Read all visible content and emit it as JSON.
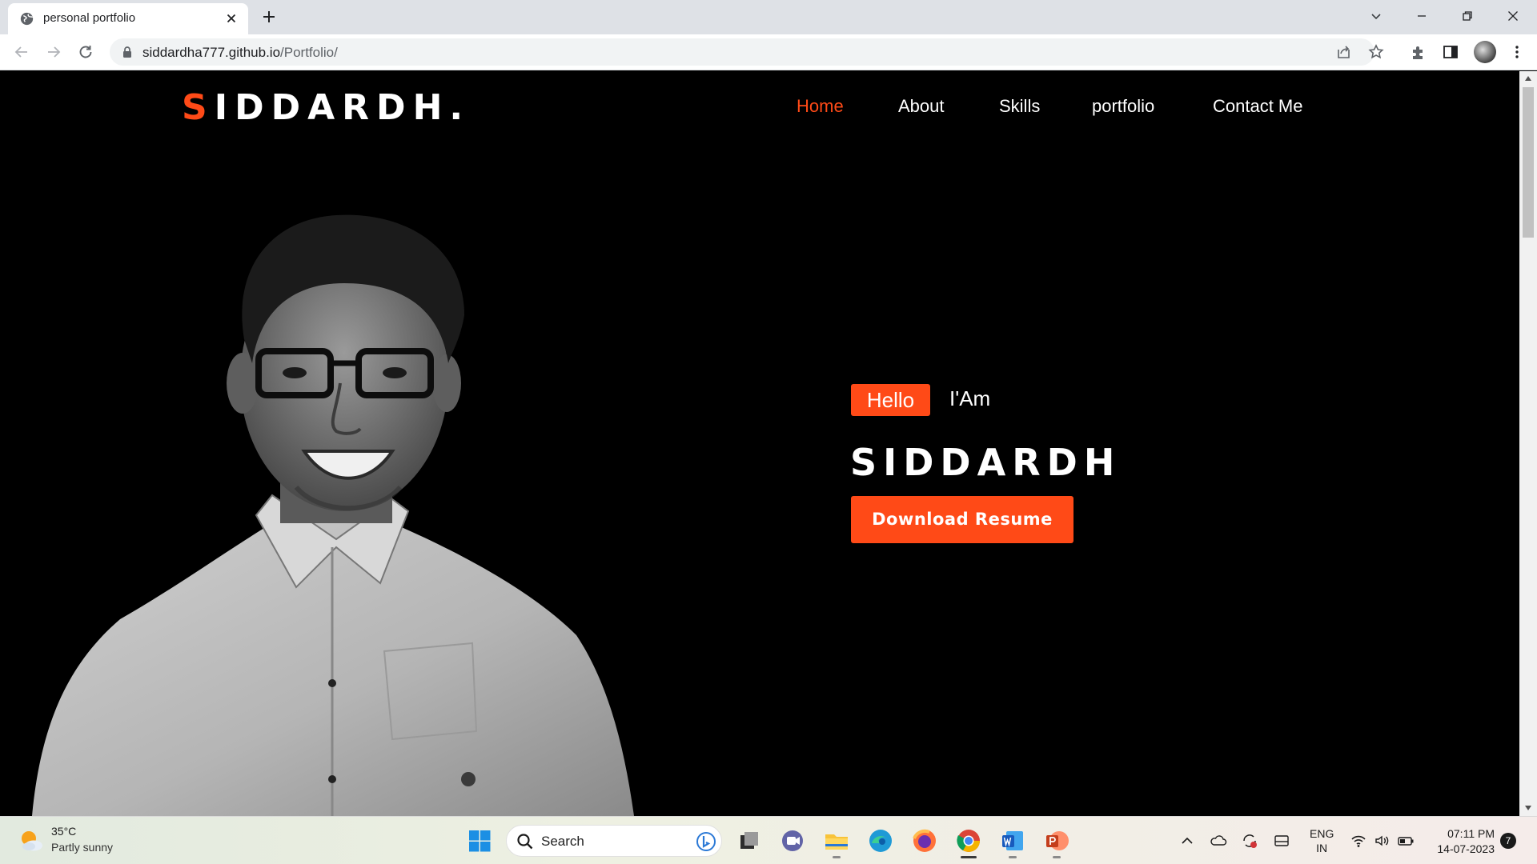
{
  "browser": {
    "tab_title": "personal portfolio",
    "url_host": "siddardha777.github.io",
    "url_path": "/Portfolio/"
  },
  "site": {
    "logo_first": "S",
    "logo_rest": "IDDARDH.",
    "nav": [
      "Home",
      "About",
      "Skills",
      "portfolio",
      "Contact Me"
    ],
    "active_nav": "Home",
    "hello_label": "Hello",
    "iam_label": "I'Am",
    "name": "SIDDARDH",
    "download_label": "Download Resume",
    "accent_color": "#ff4a17"
  },
  "taskbar": {
    "weather_temp": "35°C",
    "weather_desc": "Partly sunny",
    "search_label": "Search",
    "lang_line1": "ENG",
    "lang_line2": "IN",
    "time": "07:11 PM",
    "date": "14-07-2023",
    "notification_count": "7",
    "pinned_apps": [
      "start-icon",
      "search",
      "task-view-icon",
      "teams-chat-icon",
      "file-explorer-icon",
      "edge-icon",
      "firefox-icon",
      "chrome-icon",
      "word-icon",
      "powerpoint-icon"
    ]
  }
}
